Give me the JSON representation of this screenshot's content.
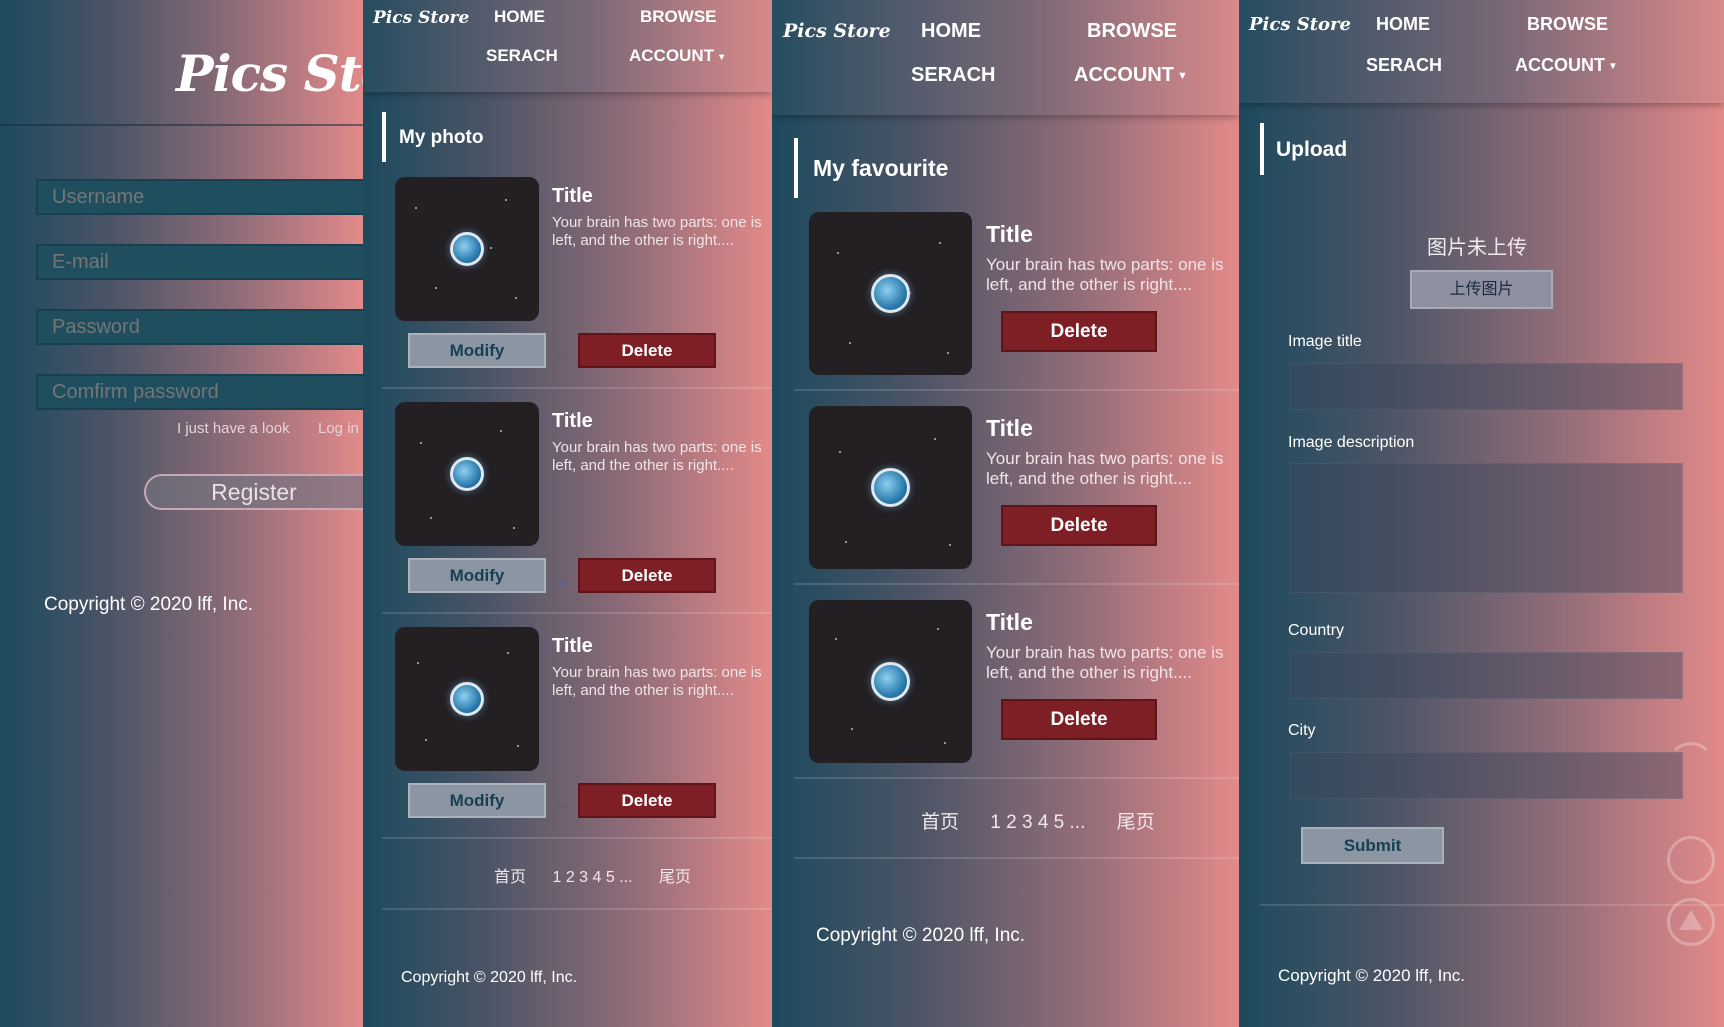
{
  "register": {
    "logo": "Pics Store",
    "username_placeholder": "Username",
    "email_placeholder": "E-mail",
    "password_placeholder": "Password",
    "confirm_placeholder": "Comfirm password",
    "look_link": "I just have a look",
    "login_link": "Log in",
    "register_button": "Register",
    "copyright": "Copyright © 2020 lff, Inc."
  },
  "nav": {
    "logo": "Pics Store",
    "home": "HOME",
    "browse": "BROWSE",
    "search": "SERACH",
    "account": "ACCOUNT",
    "caret": "▼"
  },
  "my_photo": {
    "section_title": "My photo",
    "cards": [
      {
        "title": "Title",
        "desc": "Your brain has two parts: one is left, and the other is right....",
        "modify": "Modify",
        "delete": "Delete",
        "dash": "_"
      },
      {
        "title": "Title",
        "desc": "Your brain has two parts: one is left, and the other is right....",
        "modify": "Modify",
        "delete": "Delete",
        "dash": "_"
      },
      {
        "title": "Title",
        "desc": "Your brain has two parts: one is left, and the other is right....",
        "modify": "Modify",
        "delete": "Delete",
        "dash": "_"
      }
    ],
    "pager": {
      "first": "首页",
      "pages": "1 2 3 4 5 ...",
      "last": "尾页"
    },
    "copyright": "Copyright © 2020 lff, Inc."
  },
  "my_favourite": {
    "section_title": "My favourite",
    "cards": [
      {
        "title": "Title",
        "desc": "Your brain has two parts: one is left, and the other is right....",
        "delete": "Delete"
      },
      {
        "title": "Title",
        "desc": "Your brain has two parts: one is left, and the other is right....",
        "delete": "Delete"
      },
      {
        "title": "Title",
        "desc": "Your brain has two parts: one is left, and the other is right....",
        "delete": "Delete"
      }
    ],
    "pager": {
      "first": "首页",
      "pages": "1 2 3 4 5 ...",
      "last": "尾页"
    },
    "copyright": "Copyright © 2020 lff, Inc."
  },
  "upload": {
    "section_title": "Upload",
    "status": "图片未上传",
    "upload_button": "上传图片",
    "image_title_label": "Image title",
    "image_desc_label": "Image description",
    "country_label": "Country",
    "city_label": "City",
    "submit_button": "Submit",
    "copyright": "Copyright © 2020 lff, Inc."
  },
  "colors": {
    "gradient_left": "#1d4a5e",
    "gradient_right": "#e38a8a",
    "delete_button": "#7d1f24",
    "modify_button": "#8b96a2"
  }
}
